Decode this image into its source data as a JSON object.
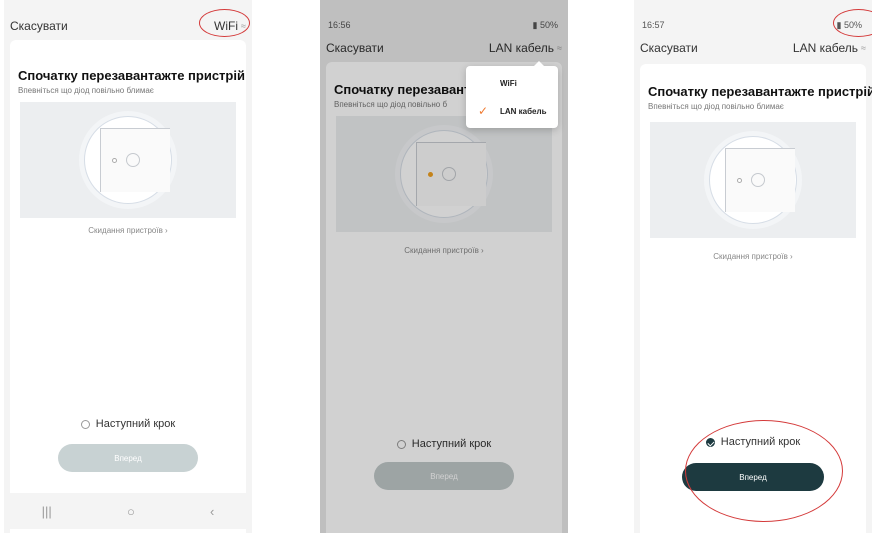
{
  "screens": [
    {
      "nav": {
        "cancel": "Скасувати",
        "mode": "WiFi"
      },
      "title": "Спочатку перезавантажте пристрій",
      "subtitle": "Впевніться що діод повільно блимає",
      "reset_link": "Скидання пристроїв",
      "next_step": "Наступний крок",
      "next_step_checked": false,
      "next_button": "Вперед",
      "sysnav": {
        "recent": "|||",
        "home": "○",
        "back": "‹"
      }
    },
    {
      "status": {
        "time": "16:56",
        "battery": "50%"
      },
      "nav": {
        "cancel": "Скасувати",
        "mode": "LAN кабель"
      },
      "title": "Спочатку перезавант",
      "subtitle": "Впевніться що діод повільно б",
      "reset_link": "Скидання пристроїв",
      "next_step": "Наступний крок",
      "next_step_checked": false,
      "next_button": "Вперед",
      "dropdown": {
        "options": [
          "WiFi",
          "LAN кабель"
        ],
        "selected": "LAN кабель"
      }
    },
    {
      "status": {
        "time": "16:57",
        "battery": "50%"
      },
      "nav": {
        "cancel": "Скасувати",
        "mode": "LAN кабель"
      },
      "title": "Спочатку перезавантажте пристрій",
      "subtitle": "Впевніться що діод повільно блимає",
      "reset_link": "Скидання пристроїв",
      "next_step": "Наступний крок",
      "next_step_checked": true,
      "next_button": "Вперед"
    }
  ],
  "colors": {
    "accent_dark": "#1d3a40",
    "highlight_ellipse": "#d43a3a",
    "check_orange": "#f07a30",
    "led_orange": "#f0a020"
  }
}
